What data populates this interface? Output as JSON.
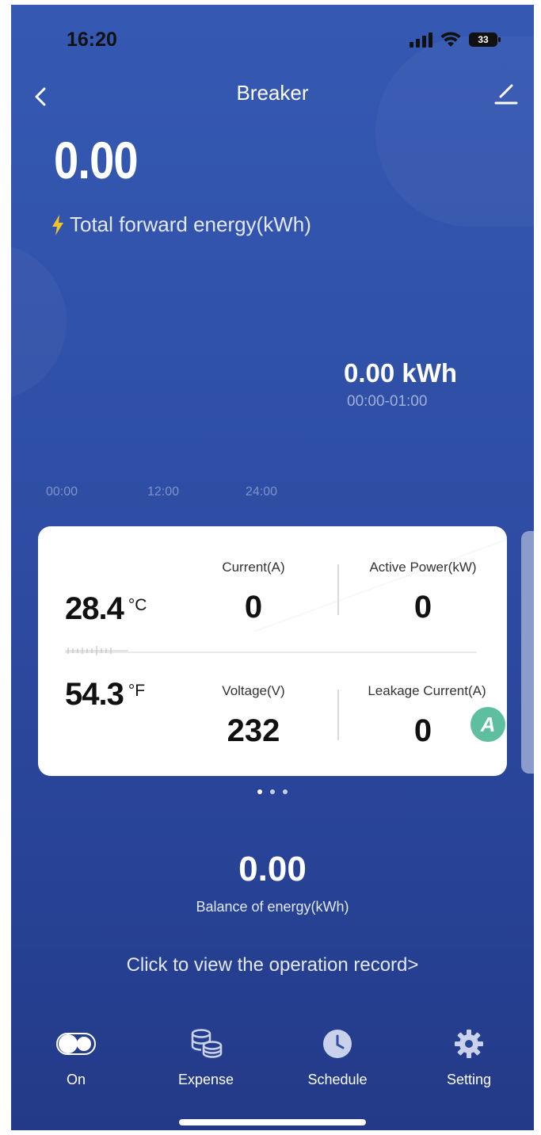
{
  "status_bar": {
    "time": "16:20",
    "battery": "33"
  },
  "header": {
    "title": "Breaker"
  },
  "total_energy": {
    "value": "0.00",
    "label": "Total forward energy(kWh)"
  },
  "chart": {
    "value": "0.00 kWh",
    "range": "00:00-01:00",
    "ticks": [
      "00:00",
      "12:00",
      "24:00"
    ]
  },
  "card": {
    "temp_c": {
      "value": "28.4",
      "unit": "°C"
    },
    "temp_f": {
      "value": "54.3",
      "unit": "°F"
    },
    "current": {
      "label": "Current(A)",
      "value": "0"
    },
    "active_power": {
      "label": "Active Power(kW)",
      "value": "0"
    },
    "voltage": {
      "label": "Voltage(V)",
      "value": "232"
    },
    "leakage_current": {
      "label": "Leakage Current(A)",
      "value": "0"
    },
    "badge": "A"
  },
  "balance": {
    "value": "0.00",
    "label": "Balance of energy(kWh)"
  },
  "operation_record": "Click to view the operation record>",
  "nav": {
    "on": "On",
    "expense": "Expense",
    "schedule": "Schedule",
    "setting": "Setting"
  },
  "colors": {
    "background_top": "#3559b3",
    "background_bottom": "#233a87",
    "bolt": "#f6c327",
    "badge": "#5dbf9f"
  }
}
